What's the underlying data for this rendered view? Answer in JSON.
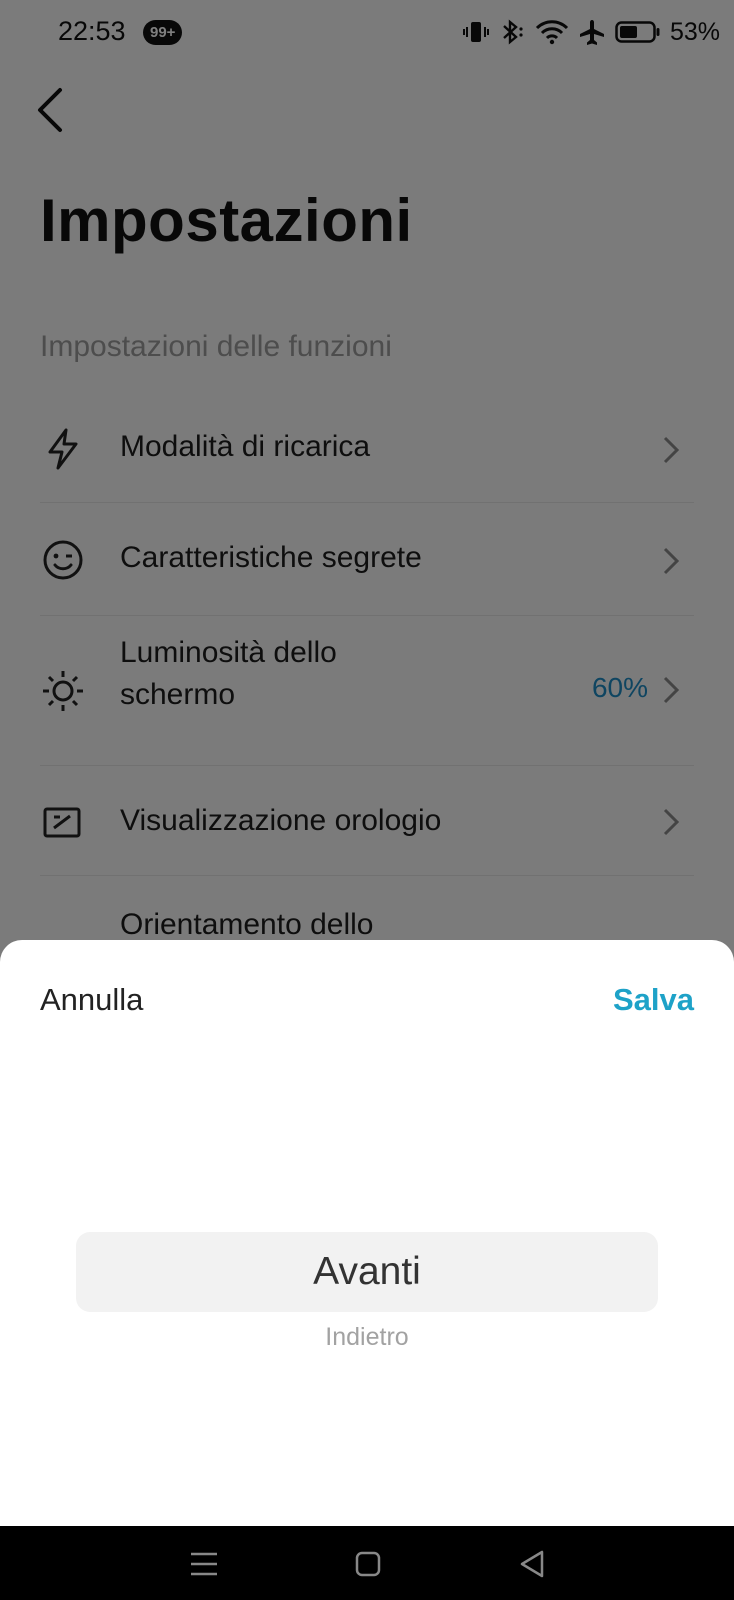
{
  "status_bar": {
    "time": "22:53",
    "notification_badge": "99+",
    "battery_percent": "53%",
    "icons": [
      "vibrate-icon",
      "bluetooth-icon",
      "wifi-icon",
      "airplane-icon",
      "battery-icon"
    ]
  },
  "header": {
    "back_icon": "chevron-left-icon",
    "title": "Impostazioni"
  },
  "section": {
    "label": "Impostazioni delle funzioni"
  },
  "settings": {
    "items": [
      {
        "icon": "lightning-icon",
        "label": "Modalità di ricarica"
      },
      {
        "icon": "smiley-icon",
        "label": "Caratteristiche segrete"
      },
      {
        "icon": "sun-icon",
        "label_line1": "Luminosità dello",
        "label_line2": "schermo",
        "value": "60%"
      },
      {
        "icon": "clock-display-icon",
        "label": "Visualizzazione orologio"
      },
      {
        "label": "Orientamento dello"
      }
    ]
  },
  "sheet": {
    "cancel_label": "Annulla",
    "save_label": "Salva",
    "options": {
      "selected": "Avanti",
      "other": "Indietro"
    }
  },
  "nav_bar": {
    "icons": [
      "menu-icon",
      "home-icon",
      "back-triangle-icon"
    ]
  },
  "colors": {
    "accent": "#1ea2c8",
    "value_blue": "#1e8bc3",
    "dim_overlay": "rgba(0,0,0,0.5)"
  }
}
